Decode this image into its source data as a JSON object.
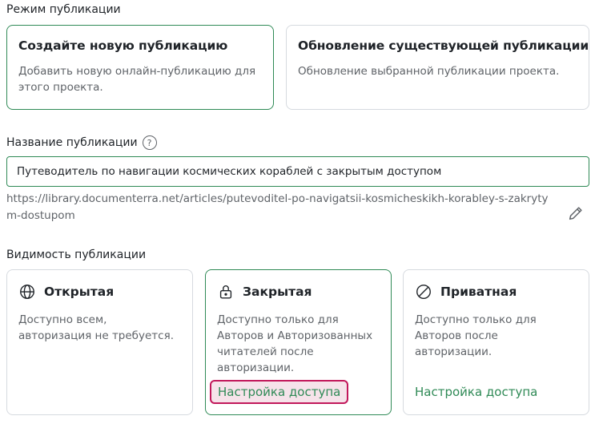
{
  "mode": {
    "label": "Режим публикации",
    "options": [
      {
        "title": "Создайте новую публикацию",
        "description": "Добавить новую онлайн-публикацию для этого проекта.",
        "selected": true
      },
      {
        "title": "Обновление существующей публикации",
        "description": "Обновление выбранной публикации проекта.",
        "selected": false
      }
    ]
  },
  "name": {
    "label": "Название публикации",
    "help_icon": "question-circle-icon",
    "value": "Путеводитель по навигации космических кораблей с закрытым доступом",
    "url": "https://library.documenterra.net/articles/putevoditel-po-navigatsii-kosmicheskikh-korabley-s-zakrytym-dostupom",
    "edit_icon": "pencil-icon"
  },
  "visibility": {
    "label": "Видимость публикации",
    "options": [
      {
        "icon": "globe-icon",
        "title": "Открытая",
        "description": "Доступно всем, авторизация не требуется.",
        "selected": false,
        "link": ""
      },
      {
        "icon": "lock-icon",
        "title": "Закрытая",
        "description": "Доступно только для Авторов и Авторизованных читателей после авторизации.",
        "selected": true,
        "link": "Настройка доступа"
      },
      {
        "icon": "no-entry-icon",
        "title": "Приватная",
        "description": "Доступно только для Авторов после авторизации.",
        "selected": false,
        "link": "Настройка доступа"
      }
    ]
  },
  "colors": {
    "accent": "#2f8a56",
    "highlight_border": "#c2185b",
    "highlight_fill": "#f6e3ea"
  }
}
